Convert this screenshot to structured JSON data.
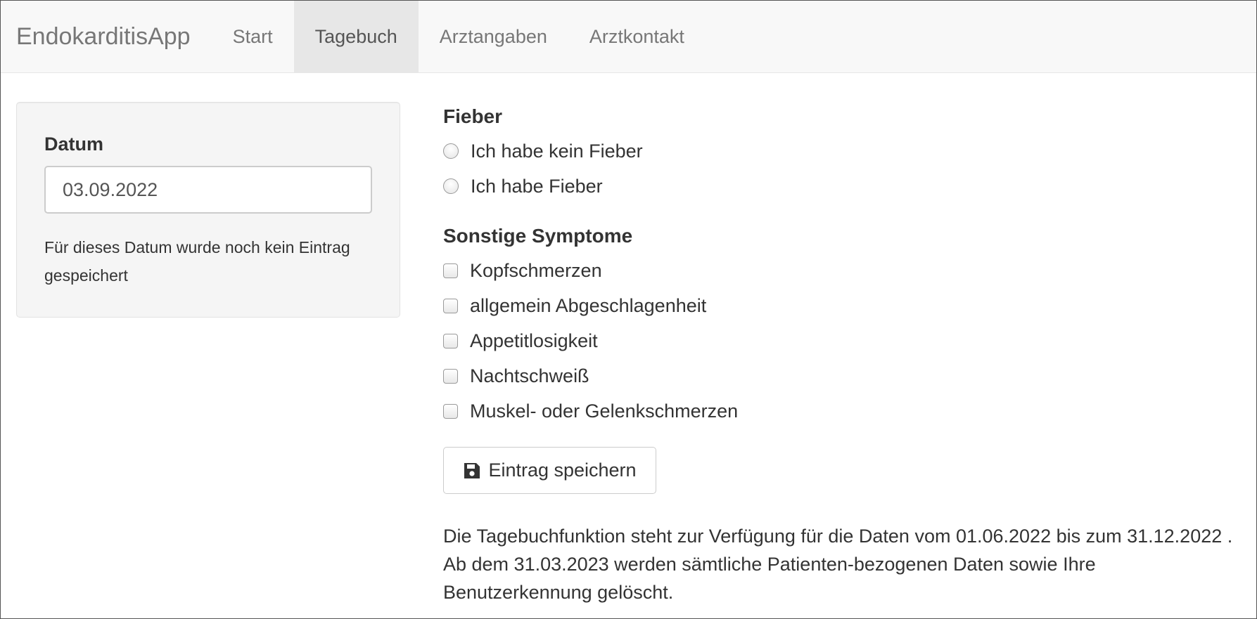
{
  "navbar": {
    "brand": "EndokarditisApp",
    "items": [
      {
        "label": "Start",
        "active": false
      },
      {
        "label": "Tagebuch",
        "active": true
      },
      {
        "label": "Arztangaben",
        "active": false
      },
      {
        "label": "Arztkontakt",
        "active": false
      }
    ]
  },
  "date_panel": {
    "label": "Datum",
    "value": "03.09.2022",
    "note": "Für dieses Datum wurde noch kein Eintrag gespeichert"
  },
  "fever": {
    "title": "Fieber",
    "options": [
      {
        "label": "Ich habe kein Fieber",
        "checked": false
      },
      {
        "label": "Ich habe Fieber",
        "checked": false
      }
    ]
  },
  "symptoms": {
    "title": "Sonstige Symptome",
    "options": [
      {
        "label": "Kopfschmerzen",
        "checked": false
      },
      {
        "label": "allgemein Abgeschlagenheit",
        "checked": false
      },
      {
        "label": "Appetitlosigkeit",
        "checked": false
      },
      {
        "label": "Nachtschweiß",
        "checked": false
      },
      {
        "label": "Muskel- oder Gelenkschmerzen",
        "checked": false
      }
    ]
  },
  "save_button": {
    "label": "Eintrag speichern",
    "icon": "floppy-disk-icon"
  },
  "info_text": "Die Tagebuchfunktion steht zur Verfügung für die Daten vom 01.06.2022 bis zum 31.12.2022 . Ab dem 31.03.2023 werden sämtliche Patienten-bezogenen Daten sowie Ihre Benutzerkennung gelöscht.",
  "colors": {
    "navbar_bg": "#f8f8f8",
    "active_tab_bg": "#e7e7e7",
    "nav_text": "#777777",
    "well_bg": "#f5f5f5"
  }
}
